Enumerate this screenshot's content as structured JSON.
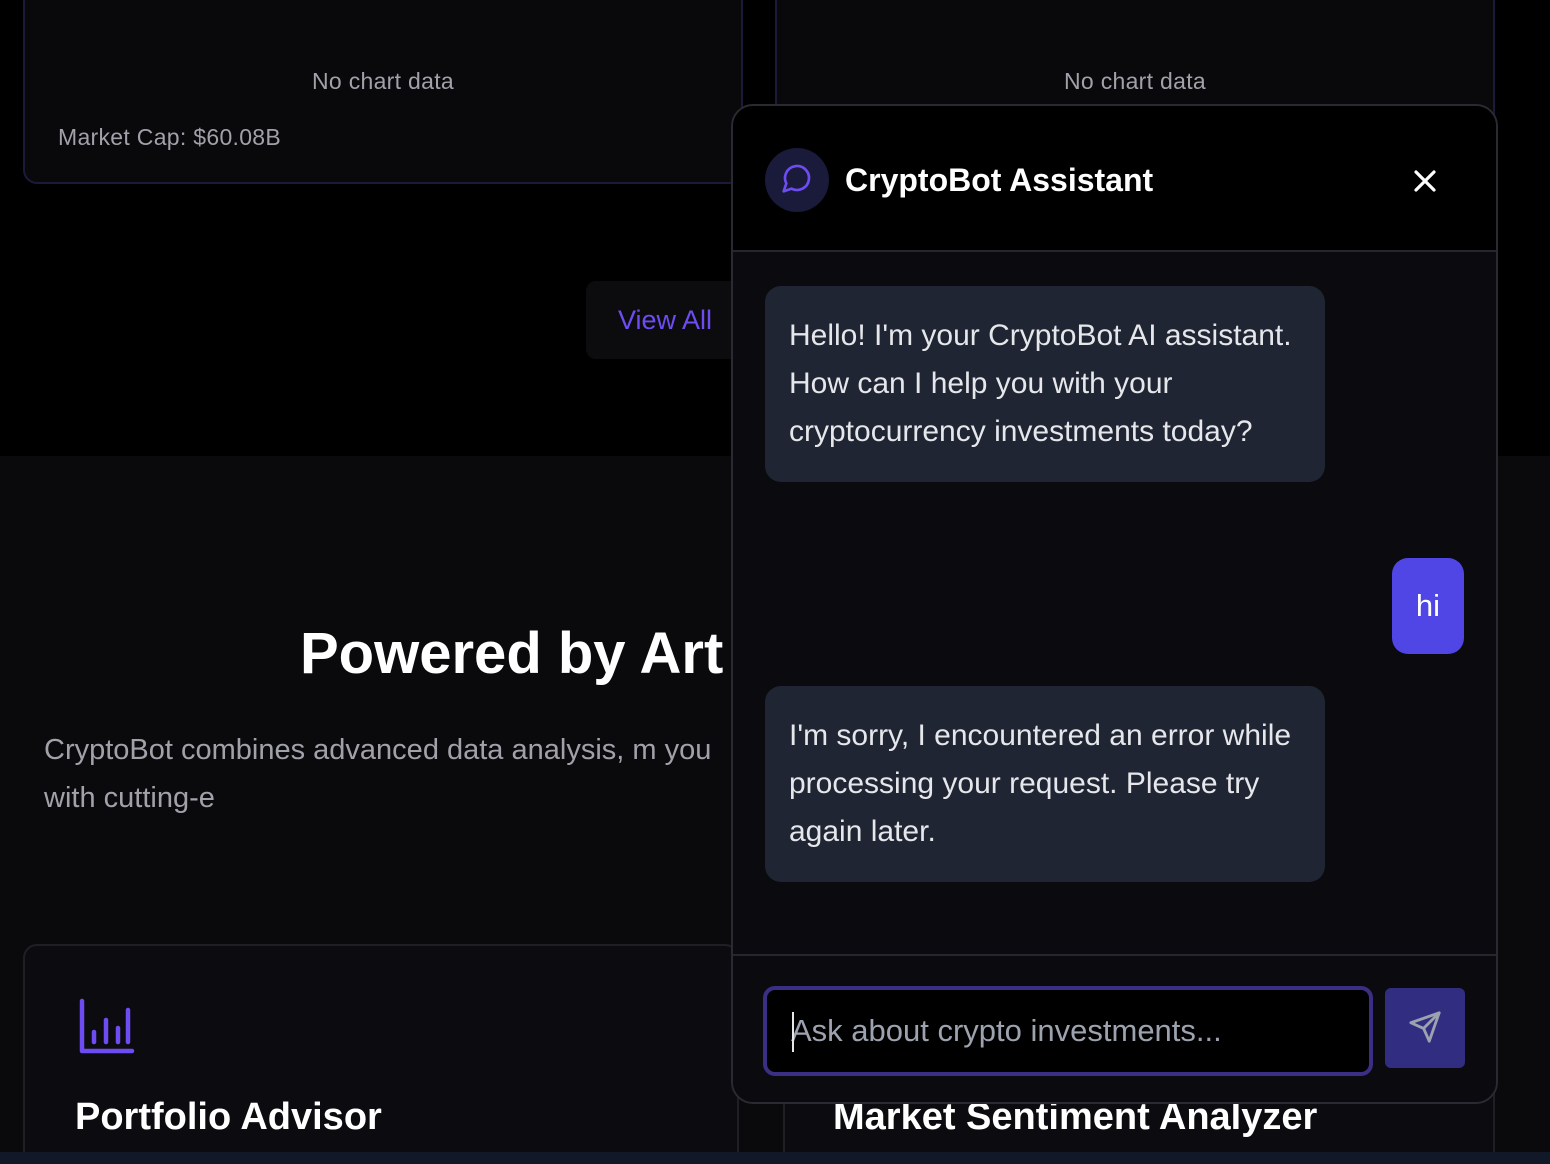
{
  "top": {
    "cards": [
      {
        "no_chart": "No chart data",
        "market_cap": "Market Cap: $60.08B"
      },
      {
        "no_chart": "No chart data"
      }
    ],
    "view_all": "View All"
  },
  "features": {
    "title": "Powered by Art",
    "description": "CryptoBot combines advanced data analysis, m you with cutting-e",
    "cards": [
      {
        "title": "Portfolio Advisor",
        "icon": "bar-chart-icon"
      },
      {
        "title": "Market Sentiment Analyzer"
      }
    ]
  },
  "chat": {
    "title": "CryptoBot Assistant",
    "avatar_icon": "chat-bubble-icon",
    "close_icon": "close-icon",
    "messages": [
      {
        "role": "bot",
        "text": "Hello! I'm your CryptoBot AI assistant. How can I help you with your cryptocurrency investments today?"
      },
      {
        "role": "user",
        "text": "hi"
      },
      {
        "role": "bot",
        "text": "I'm sorry, I encountered an error while processing your request. Please try again later."
      }
    ],
    "input_placeholder": "Ask about crypto investments...",
    "send_icon": "send-icon"
  },
  "colors": {
    "accent": "#6d4df2",
    "user_bubble": "#4f46e5",
    "bot_bubble": "#1f2533",
    "send_button": "#312e81"
  }
}
